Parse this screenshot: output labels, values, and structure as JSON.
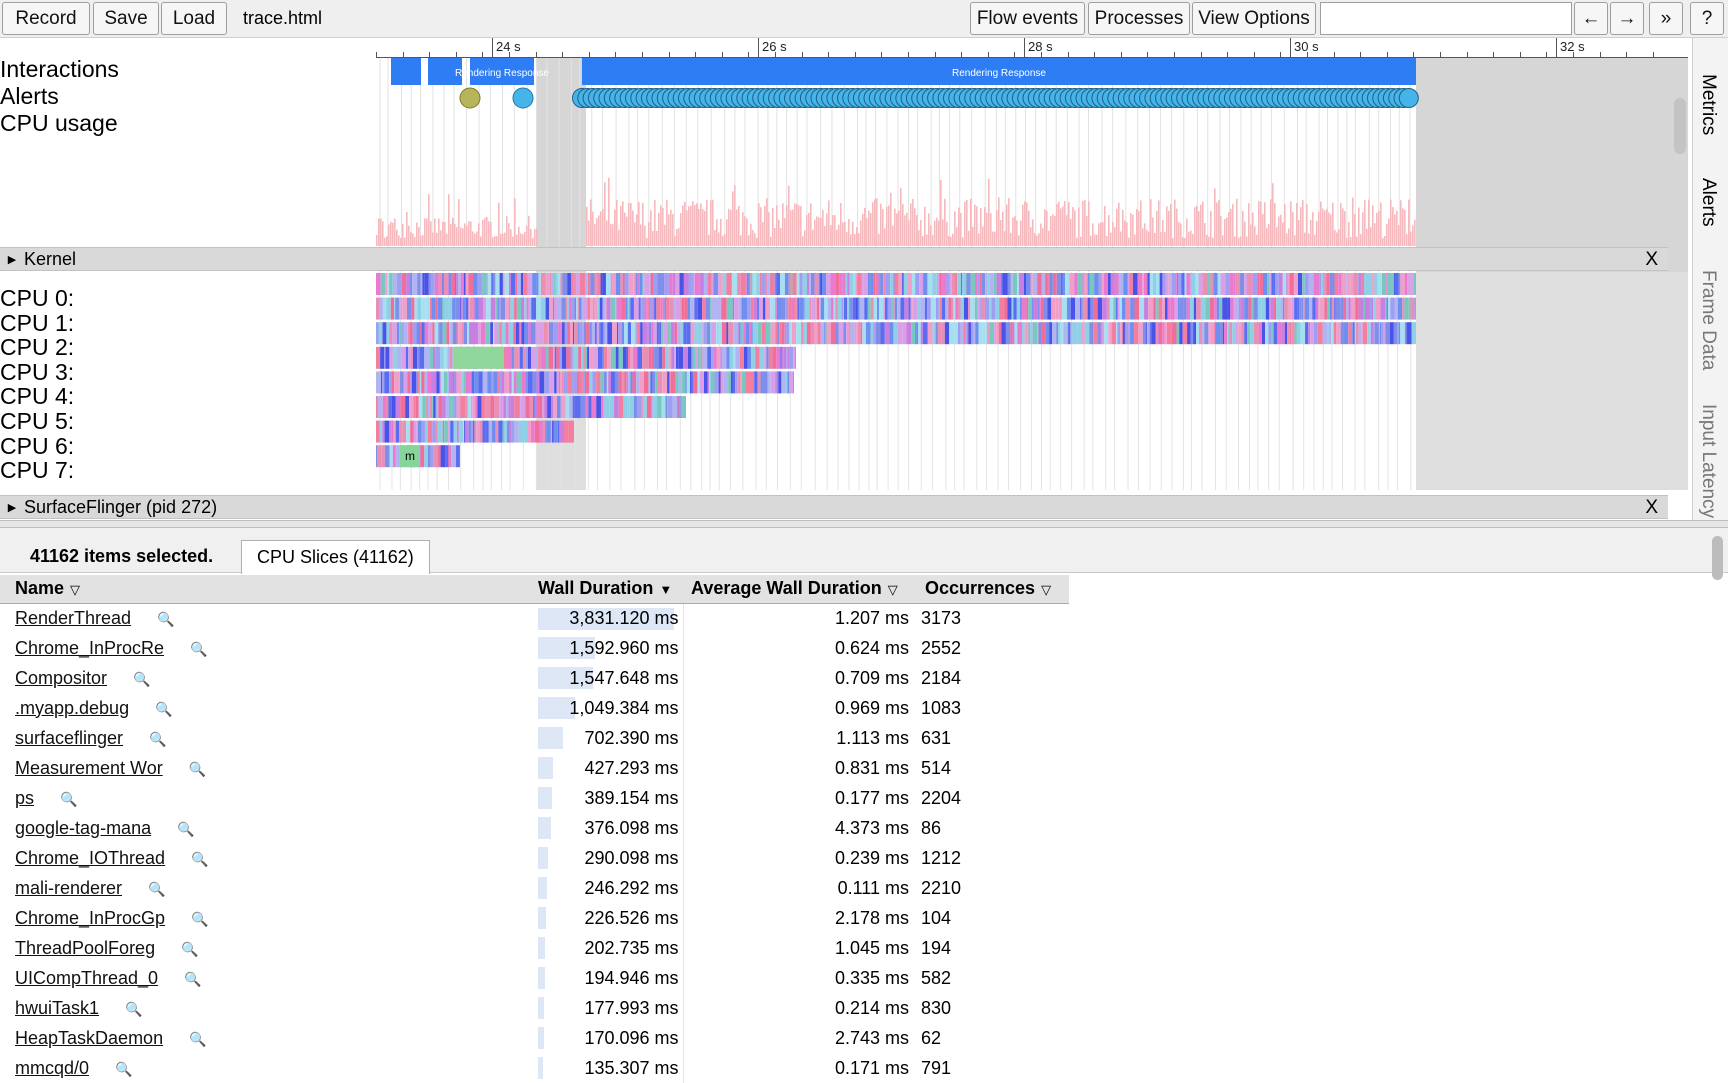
{
  "toolbar": {
    "record": "Record",
    "save": "Save",
    "load": "Load",
    "filename": "trace.html",
    "flow_events": "Flow events",
    "processes": "Processes",
    "view_options": "View Options",
    "nav_back": "←",
    "nav_forward": "→",
    "more": "»",
    "help": "?"
  },
  "ruler": {
    "labels": [
      "24 s",
      "26 s",
      "28 s",
      "30 s",
      "32 s"
    ]
  },
  "tracks": {
    "interactions": "Interactions",
    "alerts": "Alerts",
    "cpu_usage": "CPU usage",
    "rendering_response": "Rendering Response",
    "cpu_lanes": [
      "CPU 0:",
      "CPU 1:",
      "CPU 2:",
      "CPU 3:",
      "CPU 4:",
      "CPU 5:",
      "CPU 6:",
      "CPU 7:"
    ],
    "cpu7_slice_label": "m"
  },
  "groups": {
    "kernel": "Kernel",
    "surfaceflinger": "SurfaceFlinger (pid 272)",
    "close": "X"
  },
  "side_tabs": [
    "Metrics",
    "Alerts",
    "Frame Data",
    "Input Latency"
  ],
  "panel": {
    "selected": "41162 items selected.",
    "tab": "CPU Slices (41162)",
    "columns": {
      "name": "Name",
      "wall": "Wall Duration",
      "avg": "Average Wall Duration",
      "occ": "Occurrences"
    },
    "rows": [
      {
        "name": "RenderThread",
        "wall": "3,831.120 ms",
        "wall_frac": 1.0,
        "avg": "1.207 ms",
        "occ": "3173"
      },
      {
        "name": "Chrome_InProcRe",
        "wall": "1,592.960 ms",
        "wall_frac": 0.416,
        "avg": "0.624 ms",
        "occ": "2552"
      },
      {
        "name": "Compositor",
        "wall": "1,547.648 ms",
        "wall_frac": 0.404,
        "avg": "0.709 ms",
        "occ": "2184"
      },
      {
        "name": ".myapp.debug",
        "wall": "1,049.384 ms",
        "wall_frac": 0.274,
        "avg": "0.969 ms",
        "occ": "1083"
      },
      {
        "name": "surfaceflinger",
        "wall": "702.390 ms",
        "wall_frac": 0.183,
        "avg": "1.113 ms",
        "occ": "631"
      },
      {
        "name": "Measurement Wor",
        "wall": "427.293 ms",
        "wall_frac": 0.112,
        "avg": "0.831 ms",
        "occ": "514"
      },
      {
        "name": "ps",
        "wall": "389.154 ms",
        "wall_frac": 0.102,
        "avg": "0.177 ms",
        "occ": "2204"
      },
      {
        "name": "google-tag-mana",
        "wall": "376.098 ms",
        "wall_frac": 0.098,
        "avg": "4.373 ms",
        "occ": "86"
      },
      {
        "name": "Chrome_IOThread",
        "wall": "290.098 ms",
        "wall_frac": 0.076,
        "avg": "0.239 ms",
        "occ": "1212"
      },
      {
        "name": "mali-renderer",
        "wall": "246.292 ms",
        "wall_frac": 0.064,
        "avg": "0.111 ms",
        "occ": "2210"
      },
      {
        "name": "Chrome_InProcGp",
        "wall": "226.526 ms",
        "wall_frac": 0.059,
        "avg": "2.178 ms",
        "occ": "104"
      },
      {
        "name": "ThreadPoolForeg",
        "wall": "202.735 ms",
        "wall_frac": 0.053,
        "avg": "1.045 ms",
        "occ": "194"
      },
      {
        "name": "UICompThread_0",
        "wall": "194.946 ms",
        "wall_frac": 0.051,
        "avg": "0.335 ms",
        "occ": "582"
      },
      {
        "name": "hwuiTask1",
        "wall": "177.993 ms",
        "wall_frac": 0.046,
        "avg": "0.214 ms",
        "occ": "830"
      },
      {
        "name": "HeapTaskDaemon",
        "wall": "170.096 ms",
        "wall_frac": 0.044,
        "avg": "2.743 ms",
        "occ": "62"
      },
      {
        "name": "mmcqd/0",
        "wall": "135.307 ms",
        "wall_frac": 0.035,
        "avg": "0.171 ms",
        "occ": "791"
      }
    ]
  },
  "colors": {
    "interaction_bar": "#2f7df5",
    "alert_warning": "#b8b45a",
    "alert_info": "#46b4e8",
    "cpu_usage": "#f6b9bd",
    "selection_gray": "#d6d6d6"
  }
}
